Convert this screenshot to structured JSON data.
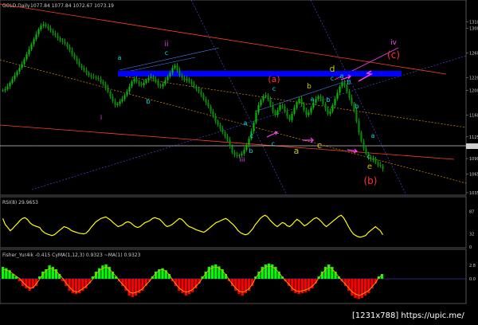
{
  "header": {
    "symbol_title": "GOLD,Daily",
    "ohlc": "1077.84 1077.84 1072.67 1073.19"
  },
  "chart_data": [
    {
      "type": "candlestick",
      "panel": "price",
      "title": "GOLD,Daily",
      "ylim": [
        1040,
        1330
      ],
      "y_ticks": [
        1310,
        1300,
        1260,
        1220,
        1200,
        1160,
        1125,
        1090,
        1065,
        1035
      ],
      "y_tick_labels": [
        "1310",
        "1300",
        "1260",
        "1220",
        "1200",
        "1160",
        "1125",
        "1090",
        "1065",
        "1035"
      ],
      "close": [
        1200,
        1202,
        1206,
        1212,
        1218,
        1224,
        1230,
        1236,
        1242,
        1250,
        1258,
        1266,
        1274,
        1282,
        1290,
        1298,
        1304,
        1306,
        1303,
        1300,
        1296,
        1292,
        1288,
        1284,
        1280,
        1278,
        1275,
        1270,
        1264,
        1258,
        1252,
        1246,
        1240,
        1236,
        1232,
        1228,
        1224,
        1222,
        1221,
        1220,
        1218,
        1214,
        1210,
        1204,
        1198,
        1190,
        1182,
        1176,
        1178,
        1182,
        1186,
        1192,
        1198,
        1206,
        1214,
        1218,
        1214,
        1210,
        1208,
        1212,
        1216,
        1220,
        1222,
        1218,
        1214,
        1208,
        1206,
        1210,
        1216,
        1222,
        1228,
        1236,
        1240,
        1232,
        1224,
        1220,
        1216,
        1218,
        1214,
        1210,
        1206,
        1202,
        1198,
        1193,
        1186,
        1180,
        1174,
        1166,
        1158,
        1150,
        1144,
        1138,
        1132,
        1126,
        1120,
        1110,
        1100,
        1096,
        1094,
        1095,
        1098,
        1104,
        1112,
        1122,
        1134,
        1148,
        1164,
        1176,
        1184,
        1190,
        1192,
        1186,
        1176,
        1166,
        1160,
        1168,
        1176,
        1174,
        1166,
        1158,
        1152,
        1162,
        1172,
        1180,
        1186,
        1178,
        1168,
        1160,
        1164,
        1172,
        1180,
        1186,
        1190,
        1186,
        1178,
        1170,
        1162,
        1166,
        1176,
        1186,
        1196,
        1206,
        1212,
        1208,
        1198,
        1188,
        1178,
        1168,
        1150,
        1132,
        1118,
        1106,
        1098,
        1092,
        1088,
        1090,
        1084,
        1080,
        1078,
        1073
      ],
      "annotations": [
        {
          "text": "a",
          "color": "#00e0e0"
        },
        {
          "text": "ii",
          "color": "#ff40ff"
        },
        {
          "text": "c",
          "color": "#00e0e0"
        },
        {
          "text": "i",
          "color": "#ff40ff"
        },
        {
          "text": "b",
          "color": "#00e0e0"
        },
        {
          "text": "(a)",
          "color": "#ff3030"
        },
        {
          "text": "c",
          "color": "#00e0e0"
        },
        {
          "text": "b",
          "color": "#c8c800"
        },
        {
          "text": "a",
          "color": "#00e0e0"
        },
        {
          "text": "b",
          "color": "#00e0e0"
        },
        {
          "text": "d",
          "color": "#c8c800"
        },
        {
          "text": "c",
          "color": "#00e0e0"
        },
        {
          "text": "a",
          "color": "#00e0e0"
        },
        {
          "text": "b",
          "color": "#00e0e0"
        },
        {
          "text": "iv",
          "color": "#ff40ff"
        },
        {
          "text": "(c)",
          "color": "#ff3030"
        },
        {
          "text": "a",
          "color": "#00e0e0"
        },
        {
          "text": "b",
          "color": "#00e0e0"
        },
        {
          "text": "c",
          "color": "#00e0e0"
        },
        {
          "text": "c",
          "color": "#00e0e0"
        },
        {
          "text": "a",
          "color": "#00e0e0"
        },
        {
          "text": "a",
          "color": "#c8c800"
        },
        {
          "text": "c",
          "color": "#c8c800"
        },
        {
          "text": "b",
          "color": "#00e0e0"
        },
        {
          "text": "iii",
          "color": "#ff40ff"
        },
        {
          "text": "c",
          "color": "#00e0e0"
        },
        {
          "text": "e",
          "color": "#c8c800"
        },
        {
          "text": "(b)",
          "color": "#ff3030"
        }
      ],
      "colors": {
        "up": "#00c000",
        "down": "#00c000",
        "resistance_band": "#0000ff"
      }
    },
    {
      "type": "line",
      "panel": "rsi",
      "title": "RSI(8) 29.9653",
      "ylim": [
        0,
        100
      ],
      "y_ticks": [
        87,
        32,
        0
      ],
      "y_tick_labels": [
        "87",
        "32",
        "0"
      ],
      "values": [
        70,
        55,
        48,
        40,
        45,
        52,
        58,
        65,
        70,
        72,
        68,
        60,
        55,
        52,
        50,
        48,
        40,
        35,
        32,
        30,
        28,
        30,
        35,
        40,
        45,
        50,
        48,
        45,
        40,
        38,
        36,
        34,
        33,
        32,
        34,
        40,
        48,
        55,
        62,
        66,
        70,
        72,
        74,
        70,
        66,
        60,
        55,
        50,
        52,
        55,
        60,
        62,
        60,
        55,
        50,
        48,
        50,
        55,
        60,
        62,
        65,
        70,
        72,
        70,
        68,
        62,
        55,
        50,
        52,
        55,
        60,
        65,
        70,
        68,
        62,
        55,
        50,
        48,
        45,
        42,
        40,
        38,
        36,
        40,
        45,
        50,
        55,
        60,
        62,
        65,
        68,
        70,
        66,
        60,
        55,
        48,
        40,
        35,
        32,
        30,
        32,
        38,
        45,
        55,
        62,
        70,
        75,
        78,
        74,
        66,
        60,
        54,
        50,
        55,
        60,
        58,
        52,
        50,
        55,
        62,
        68,
        64,
        58,
        52,
        55,
        60,
        65,
        70,
        72,
        68,
        62,
        55,
        50,
        55,
        60,
        65,
        70,
        75,
        78,
        72,
        62,
        50,
        40,
        32,
        28,
        25,
        24,
        26,
        28,
        35,
        40,
        45,
        50,
        45,
        40,
        30
      ],
      "color": "#ffff00"
    },
    {
      "type": "bar+line",
      "panel": "fisher",
      "title": "Fisher_Yur4ik -0.415 CyMA(1,12,3) 0.9323 ~MA(1) 0.9323",
      "ylim": [
        -5,
        5
      ],
      "y_ticks": [
        2.8,
        0.0
      ],
      "y_tick_labels": [
        "2.8",
        "0.0"
      ],
      "histogram": [
        2.5,
        2.2,
        1.8,
        1.0,
        0.5,
        -0.5,
        -1.5,
        -2.0,
        -2.5,
        -2.0,
        -1.5,
        0.5,
        1.5,
        2.0,
        2.8,
        2.5,
        2.0,
        1.0,
        -0.5,
        -1.5,
        -2.5,
        -3.0,
        -3.2,
        -3.0,
        -2.5,
        -2.0,
        -1.0,
        0.5,
        1.5,
        2.2,
        2.8,
        3.0,
        2.5,
        1.5,
        0.5,
        -0.5,
        -1.5,
        -2.5,
        -3.5,
        -3.8,
        -3.5,
        -3.0,
        -2.5,
        -1.5,
        -0.5,
        0.5,
        1.5,
        2.0,
        2.2,
        1.8,
        1.0,
        -0.5,
        -1.5,
        -2.5,
        -3.0,
        -3.5,
        -3.2,
        -2.8,
        -2.0,
        -1.0,
        0.5,
        1.5,
        2.5,
        2.8,
        3.0,
        2.6,
        2.0,
        1.0,
        -0.5,
        -1.5,
        -2.5,
        -3.2,
        -3.5,
        -3.0,
        -2.5,
        -1.5,
        0.5,
        1.5,
        2.5,
        3.0,
        3.2,
        3.0,
        2.5,
        1.5,
        0.5,
        -0.5,
        -1.5,
        -2.5,
        -3.0,
        -3.2,
        -3.0,
        -2.8,
        -2.5,
        -2.0,
        -1.0,
        0.5,
        1.5,
        2.5,
        3.0,
        2.5,
        1.5,
        0.5,
        -0.5,
        -1.5,
        -2.5,
        -3.5,
        -4.0,
        -4.2,
        -4.0,
        -3.5,
        -3.0,
        -2.0,
        -1.0,
        0.5,
        1.0
      ],
      "signal": [
        2.0,
        1.8,
        1.5,
        1.0,
        0.5,
        0.0,
        -0.8,
        -1.5,
        -2.0,
        -1.8,
        -1.0,
        0.0,
        1.0,
        1.8,
        2.2,
        2.0,
        1.5,
        0.8,
        0.0,
        -1.0,
        -1.8,
        -2.5,
        -2.8,
        -2.5,
        -2.0,
        -1.5,
        -0.8,
        0.0,
        1.0,
        1.8,
        2.2,
        2.5,
        2.0,
        1.2,
        0.5,
        -0.5,
        -1.2,
        -2.0,
        -2.8,
        -3.0,
        -2.8,
        -2.5,
        -2.0,
        -1.2,
        -0.5,
        0.5,
        1.2,
        1.8,
        2.0,
        1.5,
        0.8,
        -0.3,
        -1.2,
        -2.0,
        -2.5,
        -2.8,
        -2.6,
        -2.2,
        -1.5,
        -0.8,
        0.3,
        1.2,
        2.0,
        2.3,
        2.5,
        2.2,
        1.6,
        0.8,
        -0.3,
        -1.2,
        -2.0,
        -2.6,
        -2.8,
        -2.5,
        -2.0,
        -1.0,
        0.3,
        1.2,
        2.0,
        2.5,
        2.7,
        2.5,
        2.0,
        1.2,
        0.3,
        -0.5,
        -1.2,
        -2.0,
        -2.5,
        -2.7,
        -2.5,
        -2.3,
        -2.0,
        -1.5,
        -0.8,
        0.3,
        1.2,
        2.0,
        2.5,
        2.0,
        1.2,
        0.3,
        -0.5,
        -1.2,
        -2.0,
        -2.8,
        -3.2,
        -3.5,
        -3.2,
        -2.8,
        -2.4,
        -1.6,
        -0.8,
        0.3,
        0.8
      ],
      "colors": {
        "positive": "#00ff00",
        "negative": "#ff0000",
        "signal": "#ffa500"
      }
    }
  ],
  "watermark": "[1231x788]  https://upic.me/"
}
